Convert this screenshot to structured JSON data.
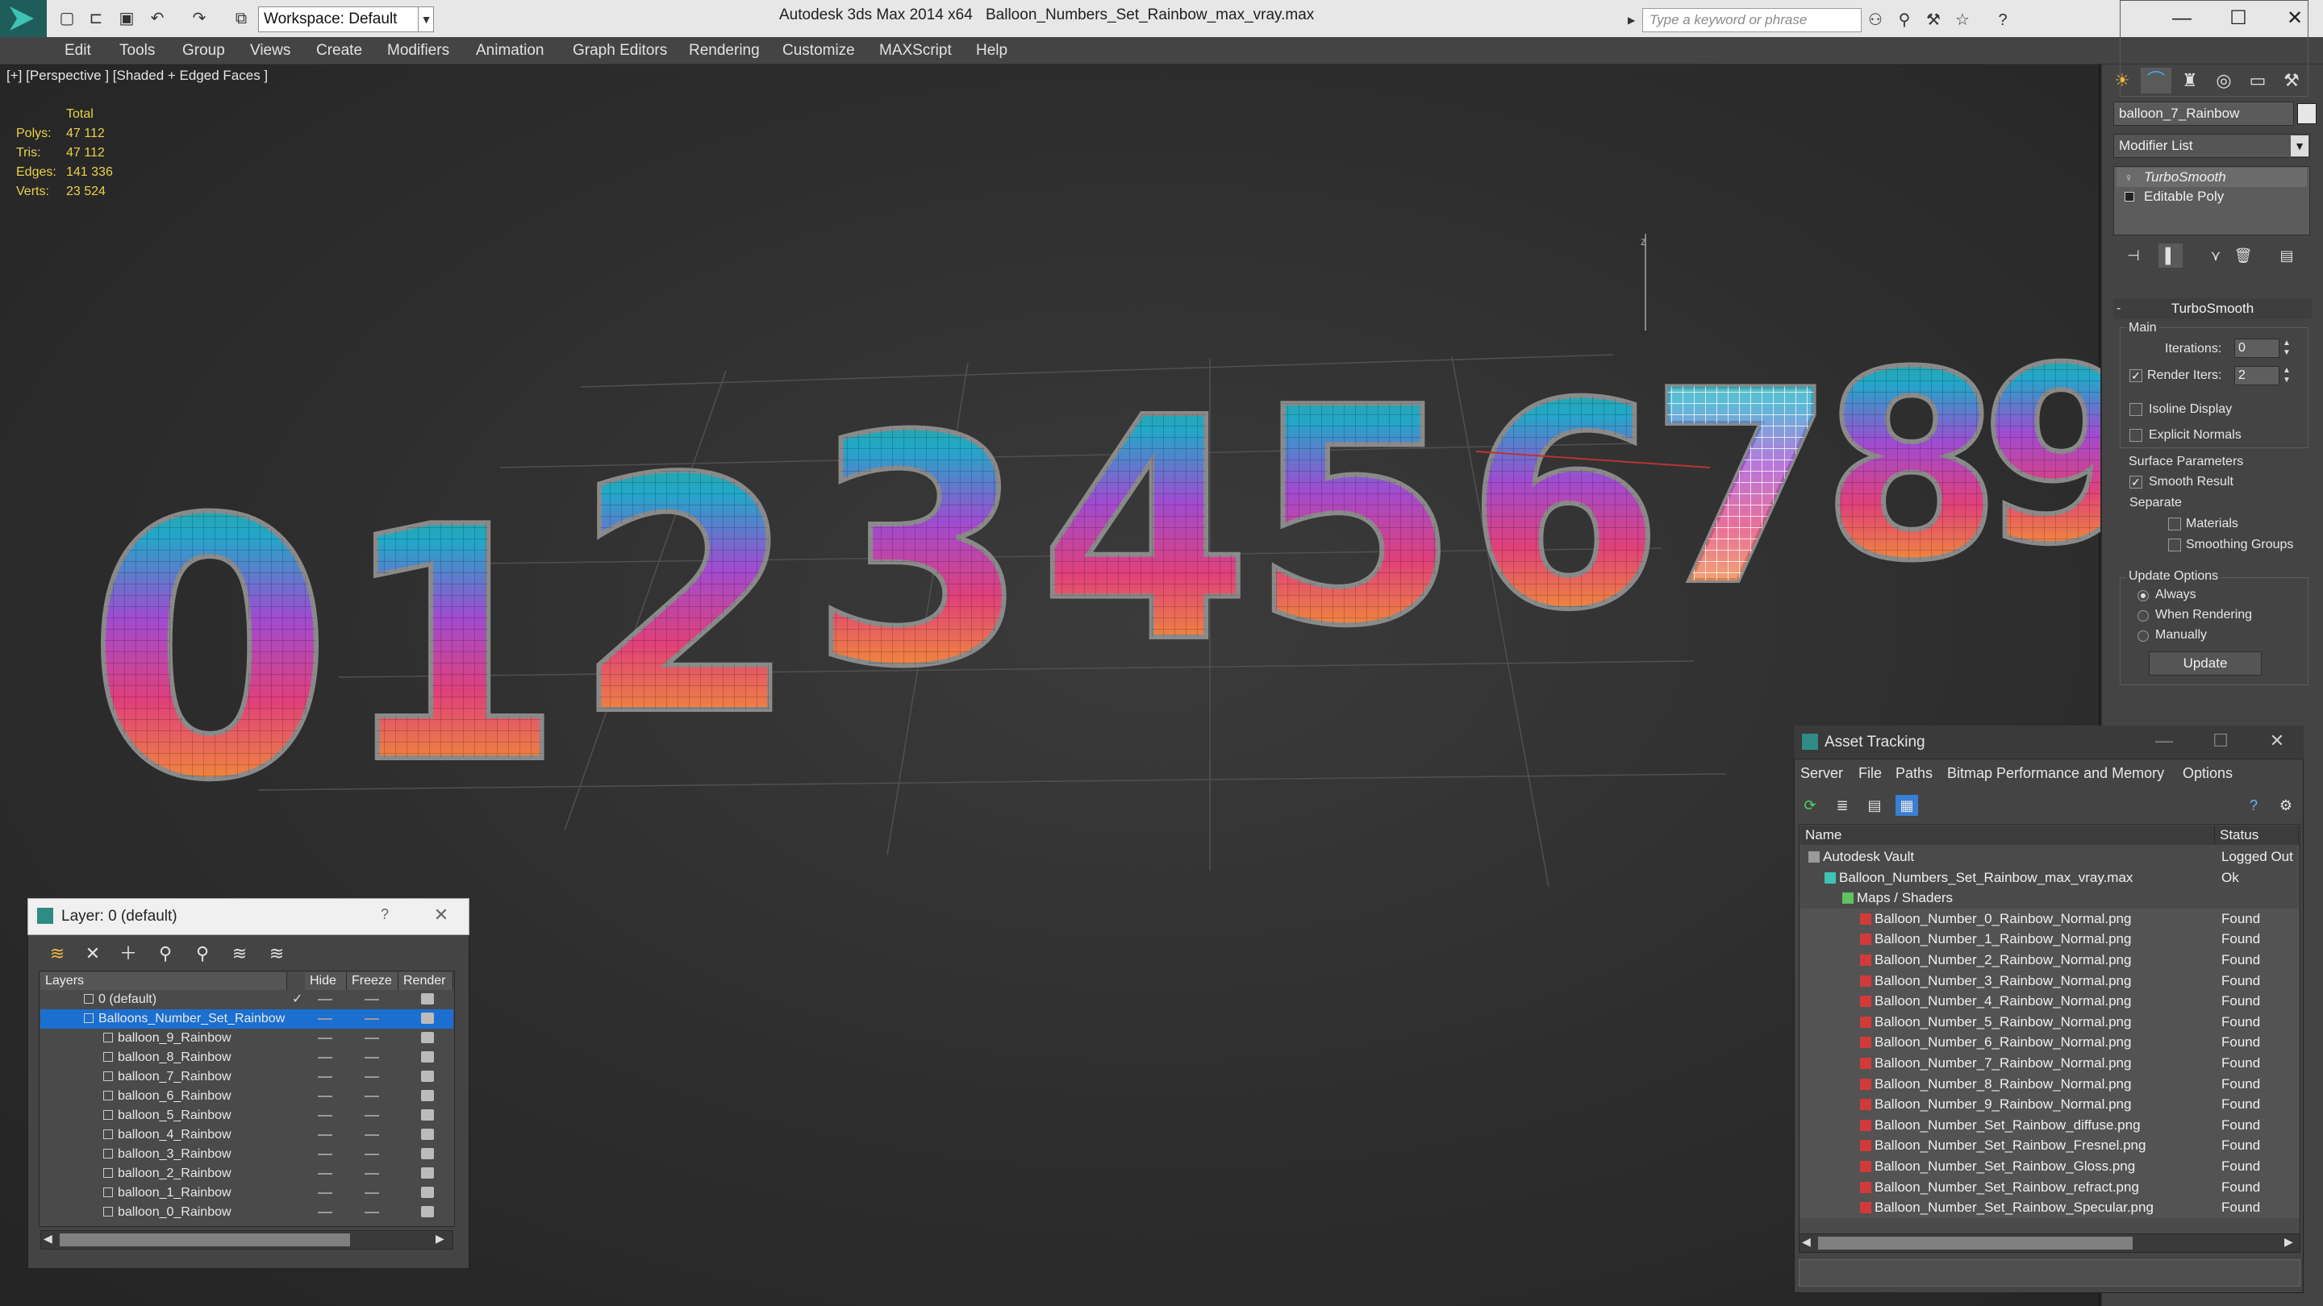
{
  "window": {
    "app_title": "Autodesk 3ds Max 2014 x64",
    "file_title": "Balloon_Numbers_Set_Rainbow_max_vray.max",
    "workspace": "Workspace: Default",
    "search_placeholder": "Type a keyword or phrase"
  },
  "menu": [
    "Edit",
    "Tools",
    "Group",
    "Views",
    "Create",
    "Modifiers",
    "Animation",
    "Graph Editors",
    "Rendering",
    "Customize",
    "MAXScript",
    "Help"
  ],
  "viewport": {
    "label": "[+] [Perspective ] [Shaded + Edged Faces ]",
    "stats_header": "Total",
    "stats": [
      {
        "label": "Polys:",
        "value": "47 112"
      },
      {
        "label": "Tris:",
        "value": "47 112"
      },
      {
        "label": "Edges:",
        "value": "141 336"
      },
      {
        "label": "Verts:",
        "value": "23 524"
      }
    ],
    "digits": [
      "0",
      "1",
      "2",
      "3",
      "4",
      "5",
      "6",
      "7",
      "8",
      "9"
    ],
    "axis_label": "z"
  },
  "command_panel": {
    "object_name": "balloon_7_Rainbow",
    "modifier_list": "Modifier List",
    "stack": [
      "TurboSmooth",
      "Editable Poly"
    ],
    "rollout_title": "TurboSmooth",
    "main_label": "Main",
    "iterations_label": "Iterations:",
    "iterations_value": "0",
    "render_iters_label": "Render Iters:",
    "render_iters_value": "2",
    "isoline_label": "Isoline Display",
    "explicit_normals_label": "Explicit Normals",
    "surface_params_label": "Surface Parameters",
    "smooth_result_label": "Smooth Result",
    "separate_label": "Separate",
    "materials_label": "Materials",
    "smoothing_groups_label": "Smoothing Groups",
    "update_options_label": "Update Options",
    "always_label": "Always",
    "when_rendering_label": "When Rendering",
    "manually_label": "Manually",
    "update_button": "Update"
  },
  "layer_dialog": {
    "title": "Layer: 0 (default)",
    "help": "?",
    "columns": [
      "Layers",
      "Hide",
      "Freeze",
      "Render"
    ],
    "rows": [
      "0 (default)",
      "Balloons_Number_Set_Rainbow",
      "balloon_9_Rainbow",
      "balloon_8_Rainbow",
      "balloon_7_Rainbow",
      "balloon_6_Rainbow",
      "balloon_5_Rainbow",
      "balloon_4_Rainbow",
      "balloon_3_Rainbow",
      "balloon_2_Rainbow",
      "balloon_1_Rainbow",
      "balloon_0_Rainbow"
    ]
  },
  "asset_tracking": {
    "title": "Asset Tracking",
    "menu": [
      "Server",
      "File",
      "Paths",
      "Bitmap Performance and Memory",
      "Options"
    ],
    "columns": [
      "Name",
      "Status"
    ],
    "rows": [
      {
        "name": "Autodesk Vault",
        "status": "Logged Out",
        "level": 0,
        "icon": "vault-icon"
      },
      {
        "name": "Balloon_Numbers_Set_Rainbow_max_vray.max",
        "status": "Ok",
        "level": 1,
        "icon": "max-file-icon"
      },
      {
        "name": "Maps / Shaders",
        "status": "",
        "level": 2,
        "icon": "maps-folder-icon"
      },
      {
        "name": "Balloon_Number_0_Rainbow_Normal.png",
        "status": "Found",
        "level": 3,
        "icon": "png-icon"
      },
      {
        "name": "Balloon_Number_1_Rainbow_Normal.png",
        "status": "Found",
        "level": 3,
        "icon": "png-icon"
      },
      {
        "name": "Balloon_Number_2_Rainbow_Normal.png",
        "status": "Found",
        "level": 3,
        "icon": "png-icon"
      },
      {
        "name": "Balloon_Number_3_Rainbow_Normal.png",
        "status": "Found",
        "level": 3,
        "icon": "png-icon"
      },
      {
        "name": "Balloon_Number_4_Rainbow_Normal.png",
        "status": "Found",
        "level": 3,
        "icon": "png-icon"
      },
      {
        "name": "Balloon_Number_5_Rainbow_Normal.png",
        "status": "Found",
        "level": 3,
        "icon": "png-icon"
      },
      {
        "name": "Balloon_Number_6_Rainbow_Normal.png",
        "status": "Found",
        "level": 3,
        "icon": "png-icon"
      },
      {
        "name": "Balloon_Number_7_Rainbow_Normal.png",
        "status": "Found",
        "level": 3,
        "icon": "png-icon"
      },
      {
        "name": "Balloon_Number_8_Rainbow_Normal.png",
        "status": "Found",
        "level": 3,
        "icon": "png-icon"
      },
      {
        "name": "Balloon_Number_9_Rainbow_Normal.png",
        "status": "Found",
        "level": 3,
        "icon": "png-icon"
      },
      {
        "name": "Balloon_Number_Set_Rainbow_diffuse.png",
        "status": "Found",
        "level": 3,
        "icon": "png-icon"
      },
      {
        "name": "Balloon_Number_Set_Rainbow_Fresnel.png",
        "status": "Found",
        "level": 3,
        "icon": "png-icon"
      },
      {
        "name": "Balloon_Number_Set_Rainbow_Gloss.png",
        "status": "Found",
        "level": 3,
        "icon": "png-icon"
      },
      {
        "name": "Balloon_Number_Set_Rainbow_refract.png",
        "status": "Found",
        "level": 3,
        "icon": "png-icon"
      },
      {
        "name": "Balloon_Number_Set_Rainbow_Specular.png",
        "status": "Found",
        "level": 3,
        "icon": "png-icon"
      }
    ]
  },
  "colors": {
    "stats_text": "#e8d24a",
    "selection": "#1b6fd0",
    "rainbow": [
      "#2fa86c",
      "#22a7c9",
      "#a04bd0",
      "#e0407a",
      "#f08a3a",
      "#e8d13a"
    ]
  }
}
